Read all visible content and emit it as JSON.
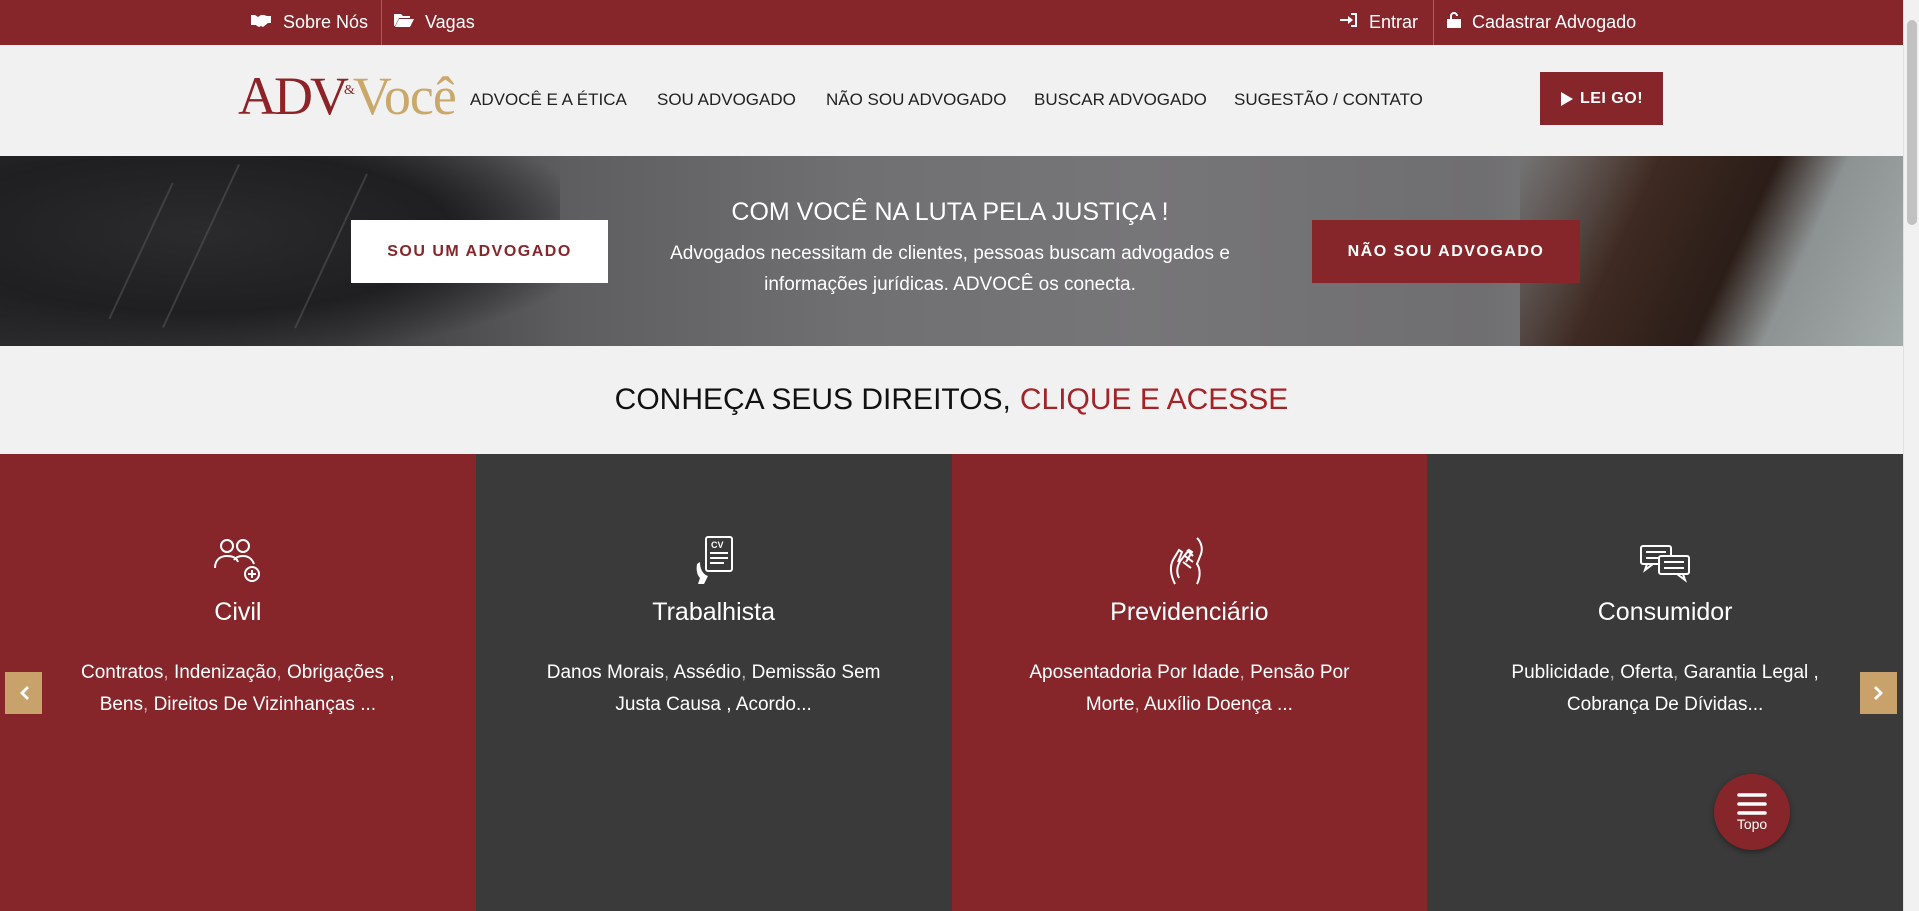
{
  "topbar": {
    "about": "Sobre Nós",
    "jobs": "Vagas",
    "login": "Entrar",
    "register": "Cadastrar Advogado"
  },
  "header": {
    "logo_adv": "ADV",
    "logo_amp": "&",
    "logo_voce": "Você",
    "nav": [
      "ADVOCÊ E A ÉTICA",
      "SOU ADVOGADO",
      "NÃO SOU ADVOGADO",
      "BUSCAR ADVOGADO",
      "SUGESTÃO / CONTATO"
    ],
    "lei_go": "LEI GO!"
  },
  "hero": {
    "left_button": "SOU UM ADVOGADO",
    "title": "COM VOCÊ NA LUTA PELA JUSTIÇA !",
    "subtitle": "Advogados necessitam de clientes, pessoas buscam advogados e informações jurídicas. ADVOCÊ os conecta.",
    "right_button": "NÃO SOU ADVOGADO"
  },
  "rights": {
    "lead": "CONHEÇA SEUS DIREITOS,",
    "accent": "CLIQUE E ACESSE"
  },
  "cards": [
    {
      "title": "Civil",
      "icon": "people-add-icon",
      "tags": [
        "Contratos",
        "Indenização",
        "Obrigações ,",
        "Bens",
        "Direitos De Vizinhanças ..."
      ]
    },
    {
      "title": "Trabalhista",
      "icon": "cv-document-icon",
      "tags": [
        "Danos Morais",
        "Assédio",
        "Demissão Sem Justa Causa ,",
        "Acordo..."
      ]
    },
    {
      "title": "Previdenciário",
      "icon": "hands-icon",
      "tags": [
        "Aposentadoria Por Idade",
        "Pensão Por Morte",
        "Auxílio Doença ..."
      ]
    },
    {
      "title": "Consumidor",
      "icon": "chat-bubbles-icon",
      "tags": [
        "Publicidade",
        "Oferta",
        "Garantia Legal ,",
        "Cobrança De Dívidas..."
      ]
    }
  ],
  "topo": "Topo",
  "colors": {
    "brand_red": "#87262a",
    "gold": "#c8a26a",
    "dark_card": "#3a3a3a",
    "accent_red": "#a52226"
  }
}
